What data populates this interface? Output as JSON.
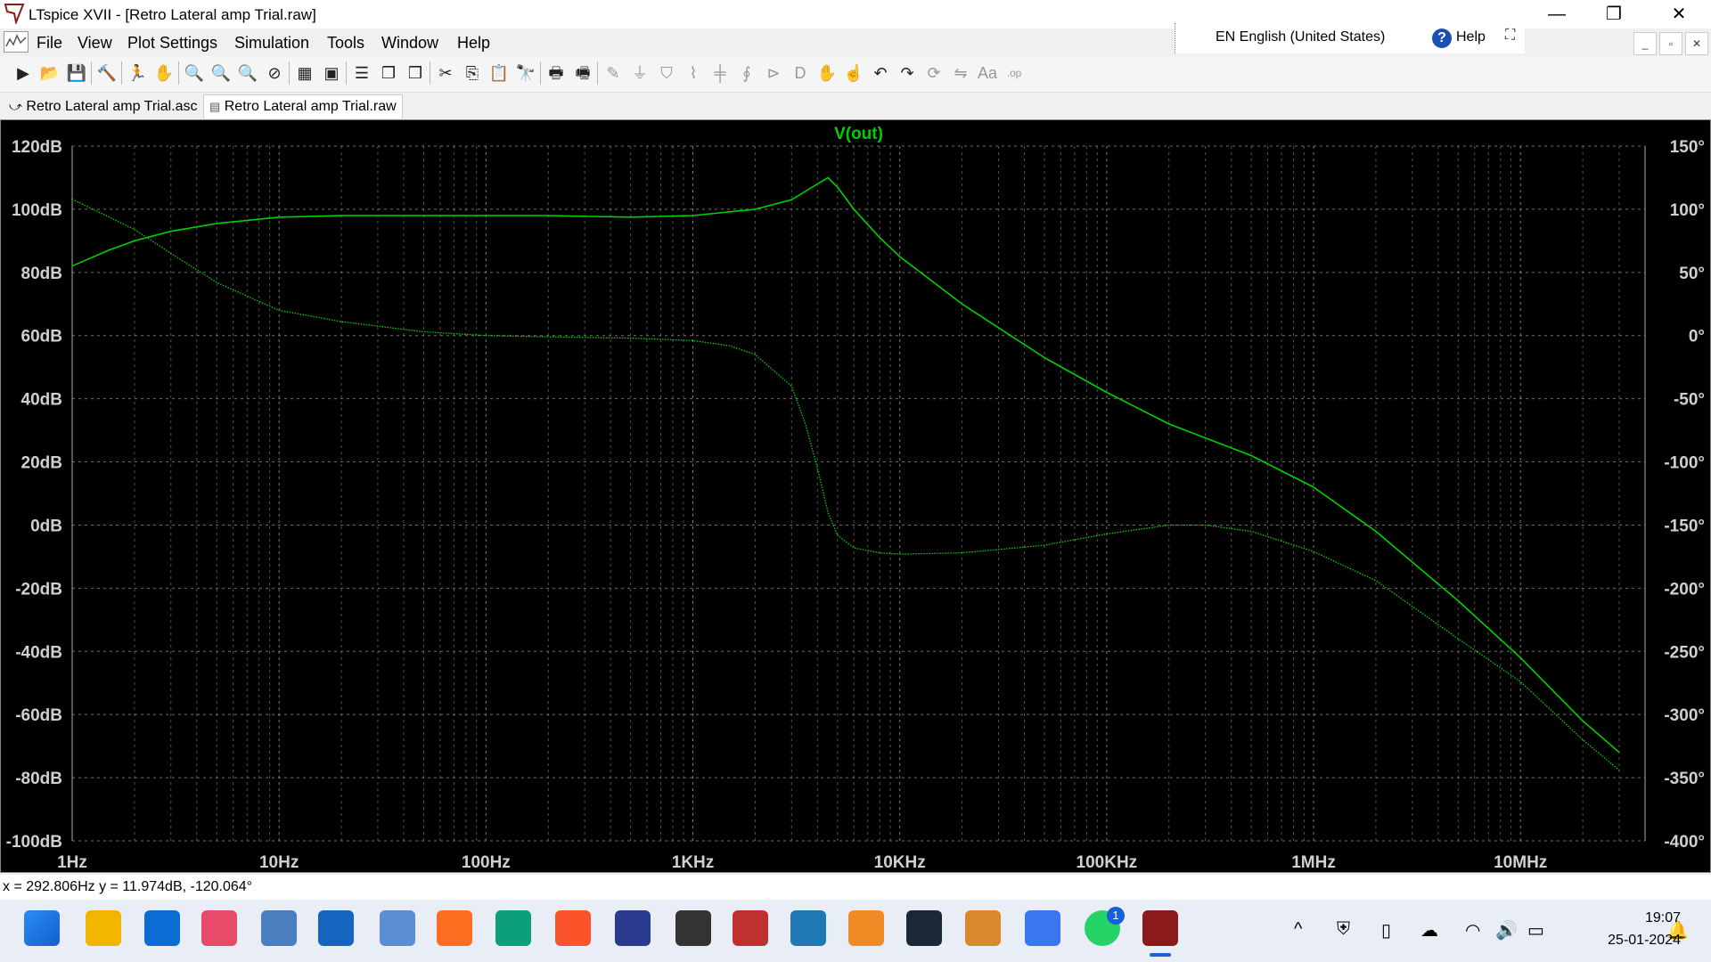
{
  "window": {
    "title": "LTspice XVII - [Retro Lateral amp Trial.raw]",
    "minimize": "—",
    "maximize": "❐",
    "close": "✕"
  },
  "language_bar": {
    "language": "EN English (United States)",
    "help": "Help",
    "help_icon": "?"
  },
  "mdi_controls": [
    "_",
    "▫",
    "✕"
  ],
  "menu": [
    "File",
    "View",
    "Plot Settings",
    "Simulation",
    "Tools",
    "Window",
    "Help"
  ],
  "toolbar_icons": [
    {
      "name": "new-schematic-icon",
      "glyph": "▶"
    },
    {
      "name": "open-icon",
      "glyph": "📂"
    },
    {
      "name": "save-icon",
      "glyph": "💾"
    },
    {
      "name": "control-panel-icon",
      "glyph": "🔨"
    },
    {
      "name": "run-icon",
      "glyph": "🏃"
    },
    {
      "name": "pan-icon",
      "glyph": "✋"
    },
    {
      "name": "zoom-in-icon",
      "glyph": "🔍"
    },
    {
      "name": "zoom-out-icon",
      "glyph": "🔍"
    },
    {
      "name": "zoom-fit-icon",
      "glyph": "🔍"
    },
    {
      "name": "zoom-cancel-icon",
      "glyph": "⊘"
    },
    {
      "name": "autorange-icon",
      "glyph": "▦"
    },
    {
      "name": "zoom-extents-icon",
      "glyph": "▣"
    },
    {
      "name": "tile-horizontal-icon",
      "glyph": "☰"
    },
    {
      "name": "cascade-icon",
      "glyph": "❐"
    },
    {
      "name": "tile-vertical-icon",
      "glyph": "❒"
    },
    {
      "name": "cut-icon",
      "glyph": "✂"
    },
    {
      "name": "copy-icon",
      "glyph": "⎘"
    },
    {
      "name": "paste-icon",
      "glyph": "📋"
    },
    {
      "name": "find-icon",
      "glyph": "🔭"
    },
    {
      "name": "print-icon",
      "glyph": "🖶"
    },
    {
      "name": "print-preview-icon",
      "glyph": "🖷"
    },
    {
      "name": "wire-icon",
      "glyph": "✎"
    },
    {
      "name": "ground-icon",
      "glyph": "⏚"
    },
    {
      "name": "label-net-icon",
      "glyph": "⛉"
    },
    {
      "name": "resistor-icon",
      "glyph": "⌇"
    },
    {
      "name": "capacitor-icon",
      "glyph": "╪"
    },
    {
      "name": "inductor-icon",
      "glyph": "∮"
    },
    {
      "name": "diode-icon",
      "glyph": "⊳"
    },
    {
      "name": "component-icon",
      "glyph": "D"
    },
    {
      "name": "move-icon",
      "glyph": "✋"
    },
    {
      "name": "drag-icon",
      "glyph": "☝"
    },
    {
      "name": "undo-icon",
      "glyph": "↶"
    },
    {
      "name": "redo-icon",
      "glyph": "↷"
    },
    {
      "name": "rotate-icon",
      "glyph": "⟳"
    },
    {
      "name": "mirror-icon",
      "glyph": "⇋"
    },
    {
      "name": "text-icon",
      "glyph": "Aa"
    },
    {
      "name": "spice-directive-icon",
      "glyph": ".op"
    }
  ],
  "tabs": [
    {
      "label": "Retro Lateral amp Trial.asc",
      "icon": "schematic-icon"
    },
    {
      "label": "Retro Lateral amp Trial.raw",
      "icon": "waveform-icon"
    }
  ],
  "status": {
    "cursor": "x = 292.806Hz    y = 11.974dB, -120.064°"
  },
  "taskbar": {
    "icons": [
      "windows-start-icon",
      "file-explorer-icon",
      "store-icon",
      "itunes-icon",
      "notepad-icon",
      "mail-icon",
      "photos-icon",
      "firefox-icon",
      "edge-icon",
      "brave-icon",
      "app-icon",
      "alienware-icon",
      "flag-app-icon",
      "bing-icon",
      "reader-icon",
      "steam-icon",
      "winamp-icon",
      "signal-icon",
      "whatsapp-icon",
      "ltspice-icon"
    ],
    "whatsapp_badge": "1",
    "time": "19:07",
    "date": "25-01-2024"
  },
  "chart_data": {
    "type": "line",
    "title": "V(out)",
    "x_scale": "log",
    "x_range_hz": [
      1,
      40000000
    ],
    "x_tick_labels": [
      "1Hz",
      "10Hz",
      "100Hz",
      "1KHz",
      "10KHz",
      "100KHz",
      "1MHz",
      "10MHz"
    ],
    "x_tick_values": [
      1,
      10,
      100,
      1000,
      10000,
      100000,
      1000000,
      10000000
    ],
    "y_left": {
      "unit": "dB",
      "range": [
        -100,
        120
      ],
      "tick_labels": [
        "120dB",
        "100dB",
        "80dB",
        "60dB",
        "40dB",
        "20dB",
        "0dB",
        "-20dB",
        "-40dB",
        "-60dB",
        "-80dB",
        "-100dB"
      ],
      "tick_values": [
        120,
        100,
        80,
        60,
        40,
        20,
        0,
        -20,
        -40,
        -60,
        -80,
        -100
      ]
    },
    "y_right": {
      "unit": "degree",
      "range": [
        -400,
        150
      ],
      "tick_labels": [
        "150°",
        "100°",
        "50°",
        "0°",
        "-50°",
        "-100°",
        "-150°",
        "-200°",
        "-250°",
        "-300°",
        "-350°",
        "-400°"
      ],
      "tick_values": [
        150,
        100,
        50,
        0,
        -50,
        -100,
        -150,
        -200,
        -250,
        -300,
        -350,
        -400
      ]
    },
    "grid": true,
    "background": "#000000",
    "color": "#00d000",
    "series": [
      {
        "name": "",
        "quantity": "magnitude",
        "style": "solid",
        "points": [
          [
            1,
            82
          ],
          [
            1.5,
            87
          ],
          [
            2,
            90
          ],
          [
            3,
            93
          ],
          [
            5,
            95.5
          ],
          [
            10,
            97.5
          ],
          [
            20,
            98
          ],
          [
            50,
            98
          ],
          [
            100,
            98
          ],
          [
            200,
            98
          ],
          [
            500,
            97.5
          ],
          [
            1000,
            98
          ],
          [
            2000,
            100
          ],
          [
            3000,
            103
          ],
          [
            4000,
            108
          ],
          [
            4500,
            110
          ],
          [
            5000,
            107
          ],
          [
            6000,
            100
          ],
          [
            8000,
            91
          ],
          [
            10000,
            85
          ],
          [
            20000,
            70
          ],
          [
            50000,
            53
          ],
          [
            100000,
            42
          ],
          [
            200000,
            32
          ],
          [
            500000,
            22
          ],
          [
            1000000,
            12
          ],
          [
            2000000,
            -2
          ],
          [
            5000000,
            -24
          ],
          [
            10000000,
            -42
          ],
          [
            20000000,
            -62
          ],
          [
            30000000,
            -72
          ]
        ]
      },
      {
        "name": "",
        "quantity": "phase",
        "style": "dotted",
        "points": [
          [
            1,
            108
          ],
          [
            2,
            84
          ],
          [
            3,
            65
          ],
          [
            5,
            42
          ],
          [
            10,
            20
          ],
          [
            20,
            11
          ],
          [
            50,
            3
          ],
          [
            100,
            0
          ],
          [
            200,
            -1
          ],
          [
            500,
            -2
          ],
          [
            1000,
            -4
          ],
          [
            1500,
            -8
          ],
          [
            2000,
            -15
          ],
          [
            3000,
            -40
          ],
          [
            3500,
            -70
          ],
          [
            4000,
            -105
          ],
          [
            4500,
            -140
          ],
          [
            5000,
            -158
          ],
          [
            6000,
            -168
          ],
          [
            8000,
            -172
          ],
          [
            10000,
            -173
          ],
          [
            20000,
            -172
          ],
          [
            50000,
            -166
          ],
          [
            100000,
            -157
          ],
          [
            200000,
            -150
          ],
          [
            300000,
            -150
          ],
          [
            500000,
            -155
          ],
          [
            1000000,
            -171
          ],
          [
            2000000,
            -194
          ],
          [
            5000000,
            -240
          ],
          [
            10000000,
            -274
          ],
          [
            20000000,
            -320
          ],
          [
            30000000,
            -344
          ]
        ]
      }
    ]
  }
}
